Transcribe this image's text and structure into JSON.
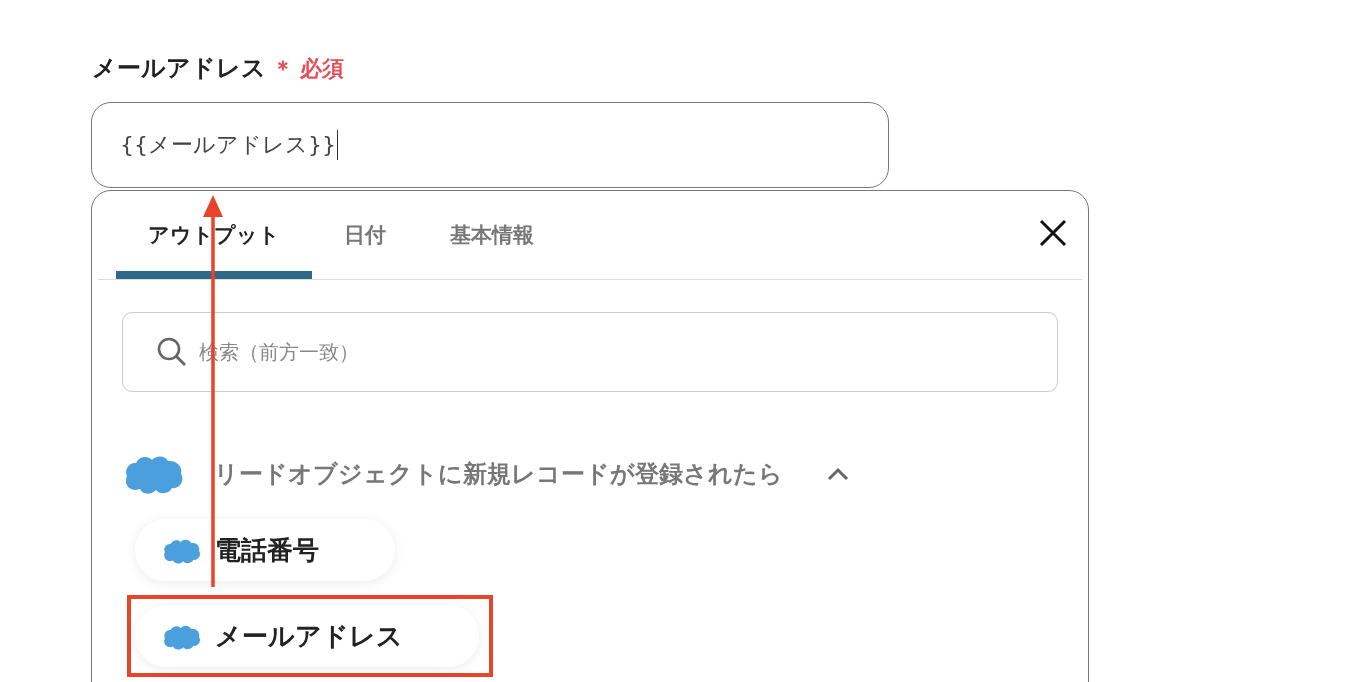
{
  "field": {
    "label": "メールアドレス",
    "required_mark": "＊",
    "required_text": "必須",
    "value": "{{メールアドレス}}"
  },
  "picker": {
    "tabs": [
      {
        "label": "アウトプット",
        "selected": true
      },
      {
        "label": "日付",
        "selected": false
      },
      {
        "label": "基本情報",
        "selected": false
      }
    ],
    "search": {
      "placeholder": "検索（前方一致）"
    },
    "group": {
      "title": "リードオブジェクトに新規レコードが登録されたら",
      "expanded": true,
      "items": [
        {
          "label": "電話番号",
          "highlighted": false
        },
        {
          "label": "メールアドレス",
          "highlighted": true
        }
      ]
    }
  }
}
